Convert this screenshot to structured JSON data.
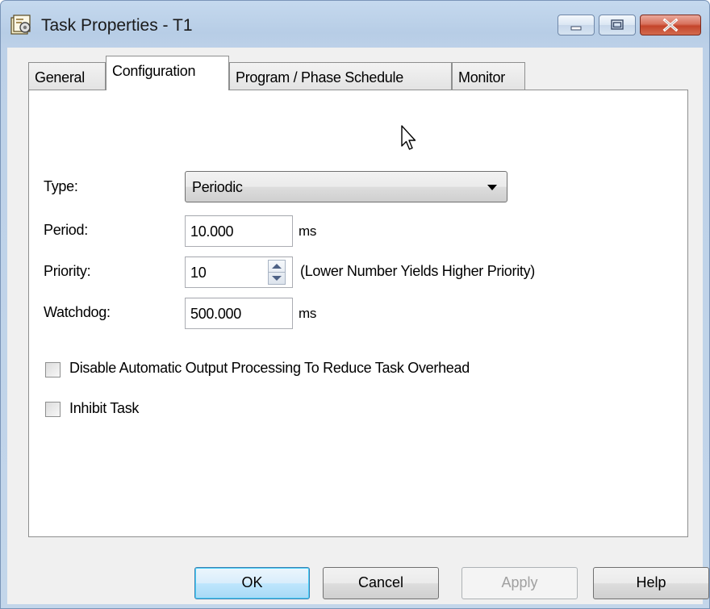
{
  "window": {
    "title": "Task Properties - T1",
    "icons": {
      "app": "task-properties-icon",
      "minimize": "minimize-icon",
      "maximize": "maximize-icon",
      "close": "close-icon"
    }
  },
  "tabs": [
    "General",
    "Configuration",
    "Program / Phase Schedule",
    "Monitor"
  ],
  "active_tab": "Configuration",
  "config": {
    "type_label": "Type:",
    "type_value": "Periodic",
    "period_label": "Period:",
    "period_value": "10.000",
    "period_unit": "ms",
    "priority_label": "Priority:",
    "priority_value": "10",
    "priority_hint": "(Lower Number Yields Higher Priority)",
    "watchdog_label": "Watchdog:",
    "watchdog_value": "500.000",
    "watchdog_unit": "ms",
    "disable_output_label": "Disable Automatic Output Processing To Reduce Task Overhead",
    "disable_output_checked": false,
    "inhibit_label": "Inhibit Task",
    "inhibit_checked": false
  },
  "buttons": {
    "ok": "OK",
    "cancel": "Cancel",
    "apply": "Apply",
    "help": "Help"
  },
  "colors": {
    "titlebar": "#bfd3ea",
    "close_button": "#c4452b",
    "ok_border": "#3c7fb1"
  }
}
